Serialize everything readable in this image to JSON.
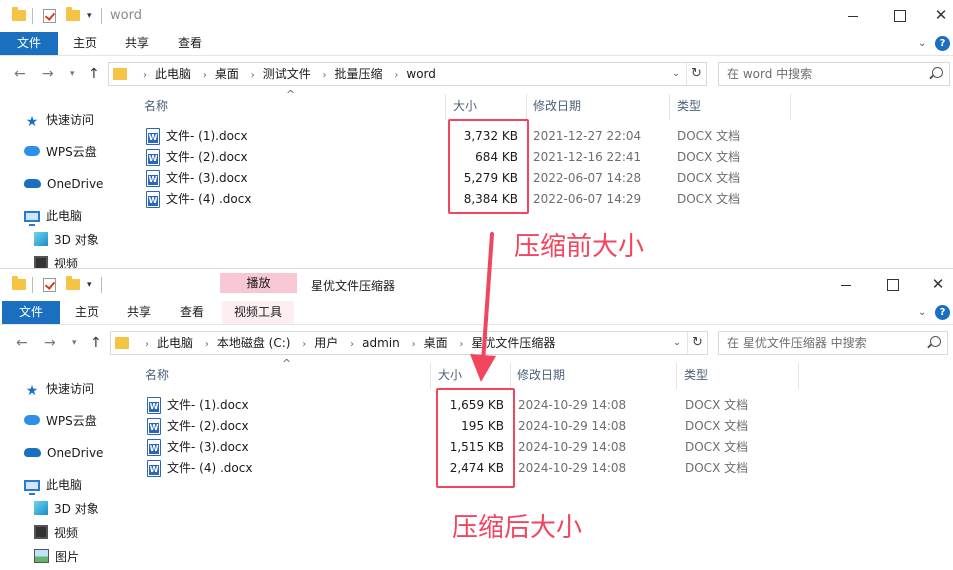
{
  "win1": {
    "title": "word",
    "tabs": [
      "文件",
      "主页",
      "共享",
      "查看"
    ],
    "breadcrumbs": [
      "此电脑",
      "桌面",
      "测试文件",
      "批量压缩",
      "word"
    ],
    "search_placeholder": "在 word 中搜索",
    "columns": {
      "name": "名称",
      "size": "大小",
      "date": "修改日期",
      "type": "类型"
    },
    "files": [
      {
        "name": "文件- (1).docx",
        "size": "3,732 KB",
        "date": "2021-12-27 22:04",
        "type": "DOCX 文档"
      },
      {
        "name": "文件- (2).docx",
        "size": "684 KB",
        "date": "2021-12-16 22:41",
        "type": "DOCX 文档"
      },
      {
        "name": "文件- (3).docx",
        "size": "5,279 KB",
        "date": "2022-06-07 14:28",
        "type": "DOCX 文档"
      },
      {
        "name": "文件- (4) .docx",
        "size": "8,384 KB",
        "date": "2022-06-07 14:29",
        "type": "DOCX 文档"
      }
    ],
    "nav": [
      "快速访问",
      "WPS云盘",
      "OneDrive",
      "此电脑",
      "3D 对象",
      "视频"
    ]
  },
  "win2": {
    "title": "星优文件压缩器",
    "context_tab_header": "播放",
    "tabs": [
      "文件",
      "主页",
      "共享",
      "查看",
      "视频工具"
    ],
    "breadcrumbs": [
      "此电脑",
      "本地磁盘 (C:)",
      "用户",
      "admin",
      "桌面",
      "星优文件压缩器"
    ],
    "search_placeholder": "在 星优文件压缩器 中搜索",
    "columns": {
      "name": "名称",
      "size": "大小",
      "date": "修改日期",
      "type": "类型"
    },
    "files": [
      {
        "name": "文件- (1).docx",
        "size": "1,659 KB",
        "date": "2024-10-29 14:08",
        "type": "DOCX 文档"
      },
      {
        "name": "文件- (2).docx",
        "size": "195 KB",
        "date": "2024-10-29 14:08",
        "type": "DOCX 文档"
      },
      {
        "name": "文件- (3).docx",
        "size": "1,515 KB",
        "date": "2024-10-29 14:08",
        "type": "DOCX 文档"
      },
      {
        "name": "文件- (4) .docx",
        "size": "2,474 KB",
        "date": "2024-10-29 14:08",
        "type": "DOCX 文档"
      }
    ],
    "nav": [
      "快速访问",
      "WPS云盘",
      "OneDrive",
      "此电脑",
      "3D 对象",
      "视频",
      "图片"
    ]
  },
  "annotations": {
    "before": "压缩前大小",
    "after": "压缩后大小"
  },
  "colors": {
    "highlight": "#f2465f",
    "file_tab": "#1a6fbf",
    "context_tab": "#f7c8d4"
  }
}
